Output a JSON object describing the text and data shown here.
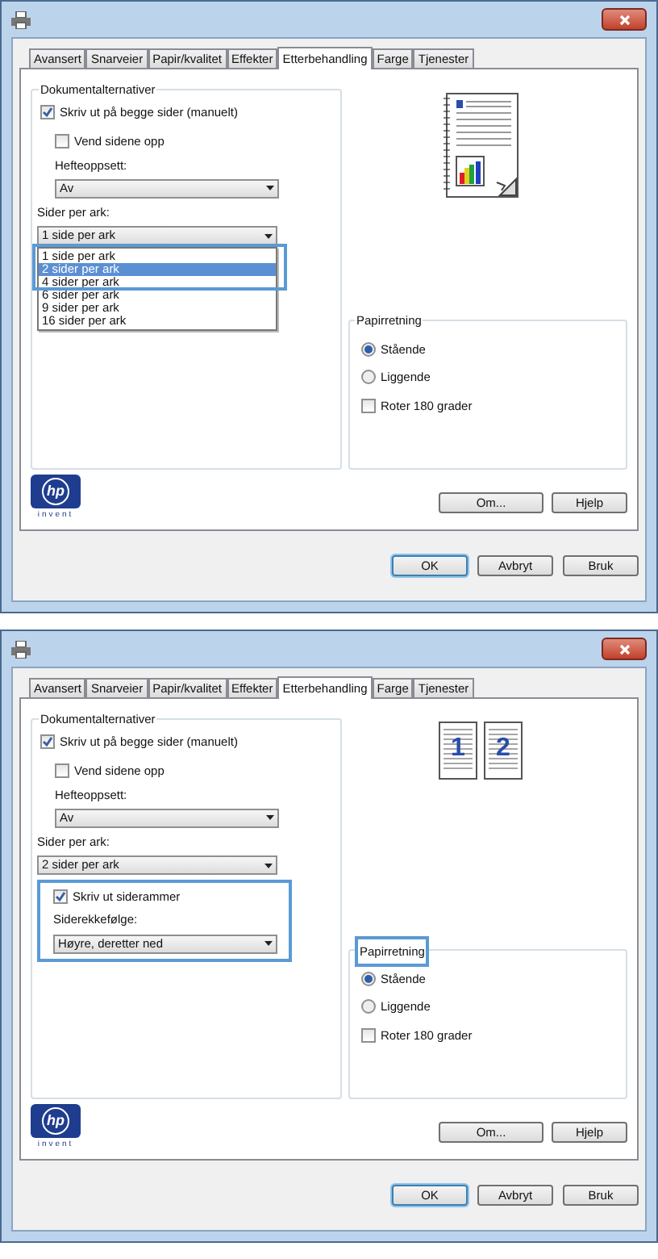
{
  "dialogs": [
    {
      "tabs": [
        {
          "label": "Avansert",
          "selected": false
        },
        {
          "label": "Snarveier",
          "selected": false
        },
        {
          "label": "Papir/kvalitet",
          "selected": false
        },
        {
          "label": "Effekter",
          "selected": false
        },
        {
          "label": "Etterbehandling",
          "selected": true
        },
        {
          "label": "Farge",
          "selected": false
        },
        {
          "label": "Tjenester",
          "selected": false
        }
      ],
      "document_options": {
        "title": "Dokumentalternativer",
        "duplex": {
          "label": "Skriv ut på begge sider (manuelt)",
          "checked": true
        },
        "flip": {
          "label": "Vend sidene opp",
          "checked": false
        },
        "booklet_label": "Hefteoppsett:",
        "booklet_value": "Av",
        "pages_label": "Sider per ark:",
        "pages_value": "1 side per ark",
        "pages_dropdown": {
          "expanded": true,
          "highlighted": true,
          "options": [
            {
              "label": "1 side per ark",
              "selected": false
            },
            {
              "label": "2 sider per ark",
              "selected": true
            },
            {
              "label": "4 sider per ark",
              "selected": false
            },
            {
              "label": "6 sider per ark",
              "selected": false
            },
            {
              "label": "9 sider per ark",
              "selected": false
            },
            {
              "label": "16 sider per ark",
              "selected": false
            }
          ]
        }
      },
      "preview": {
        "kind": "single"
      },
      "orientation": {
        "title": "Papirretning",
        "highlighted": false,
        "options": [
          {
            "label": "Stående",
            "selected": true
          },
          {
            "label": "Liggende",
            "selected": false
          }
        ],
        "rotate": {
          "label": "Roter 180 grader",
          "checked": false
        }
      },
      "logo": {
        "mark": "hp",
        "tagline": "invent"
      },
      "buttons": [
        "Om...",
        "Hjelp"
      ],
      "footer_buttons": [
        {
          "label": "OK",
          "selected": true
        },
        {
          "label": "Avbryt",
          "selected": false
        },
        {
          "label": "Bruk",
          "selected": false
        }
      ]
    },
    {
      "tabs": [
        {
          "label": "Avansert",
          "selected": false
        },
        {
          "label": "Snarveier",
          "selected": false
        },
        {
          "label": "Papir/kvalitet",
          "selected": false
        },
        {
          "label": "Effekter",
          "selected": false
        },
        {
          "label": "Etterbehandling",
          "selected": true
        },
        {
          "label": "Farge",
          "selected": false
        },
        {
          "label": "Tjenester",
          "selected": false
        }
      ],
      "document_options": {
        "title": "Dokumentalternativer",
        "duplex": {
          "label": "Skriv ut på begge sider (manuelt)",
          "checked": true
        },
        "flip": {
          "label": "Vend sidene opp",
          "checked": false
        },
        "booklet_label": "Hefteoppsett:",
        "booklet_value": "Av",
        "pages_label": "Sider per ark:",
        "pages_value": "2 sider per ark",
        "layout": {
          "highlighted": true,
          "borders": {
            "label": "Skriv ut siderammer",
            "checked": true
          },
          "order_label": "Siderekkefølge:",
          "order_value": "Høyre, deretter ned"
        }
      },
      "preview": {
        "kind": "two-up",
        "page_numbers": [
          "1",
          "2"
        ]
      },
      "orientation": {
        "title": "Papirretning",
        "highlighted": true,
        "options": [
          {
            "label": "Stående",
            "selected": true
          },
          {
            "label": "Liggende",
            "selected": false
          }
        ],
        "rotate": {
          "label": "Roter 180 grader",
          "checked": false
        }
      },
      "logo": {
        "mark": "hp",
        "tagline": "invent"
      },
      "buttons": [
        "Om...",
        "Hjelp"
      ],
      "footer_buttons": [
        {
          "label": "OK",
          "selected": true
        },
        {
          "label": "Avbryt",
          "selected": false
        },
        {
          "label": "Bruk",
          "selected": false
        }
      ]
    }
  ]
}
